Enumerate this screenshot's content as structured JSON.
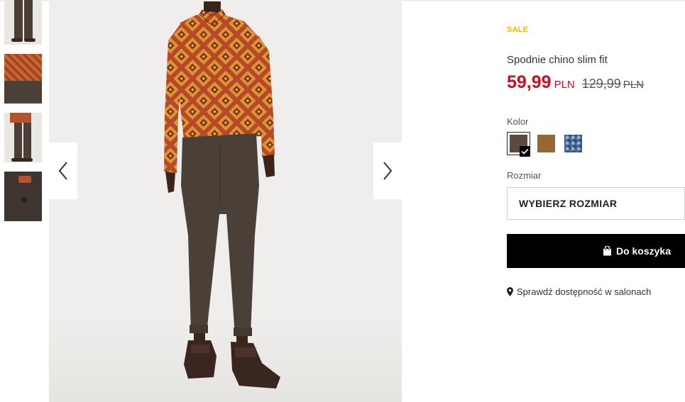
{
  "product": {
    "badge": "SALE",
    "title": "Spodnie chino slim fit",
    "price_new": "59,99",
    "price_new_currency": "PLN",
    "price_old": "129,99",
    "price_old_currency": "PLN"
  },
  "color": {
    "label": "Kolor",
    "options": [
      {
        "name": "brown",
        "hex": "#5a4a40",
        "selected": true
      },
      {
        "name": "camel",
        "hex": "#9b6d36",
        "selected": false
      },
      {
        "name": "blue-pattern",
        "hex": "#2a4c78",
        "selected": false
      }
    ]
  },
  "size": {
    "label": "Rozmiar",
    "select_placeholder": "WYBIERZ ROZMIAR"
  },
  "cart": {
    "button_label": "Do koszyka",
    "icon": "shopping-bag-icon"
  },
  "store": {
    "link_label": "Sprawdź dostępność w salonach",
    "icon": "map-pin-icon"
  },
  "gallery": {
    "thumbnail_count": 4,
    "prev_icon": "chevron-left-icon",
    "next_icon": "chevron-right-icon"
  },
  "colors": {
    "sale": "#f2b705",
    "price": "#d20a1e",
    "cart_bg": "#000000"
  }
}
